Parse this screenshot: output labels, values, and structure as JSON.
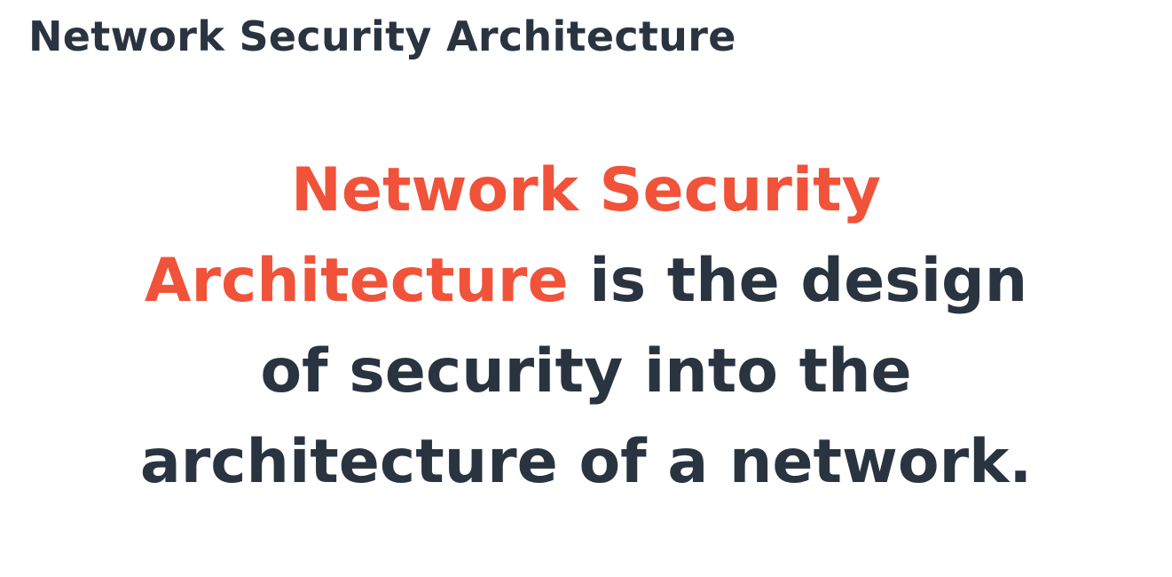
{
  "slide": {
    "title": "Network Security Architecture",
    "statement": {
      "term_line1": "Network Security",
      "term_line2": "Architecture",
      "line2_rest": " is the design",
      "line3": "of security into the",
      "line4": "architecture of a network."
    }
  },
  "colors": {
    "text": "#2a3440",
    "accent": "#f0533a",
    "background": "#ffffff"
  }
}
